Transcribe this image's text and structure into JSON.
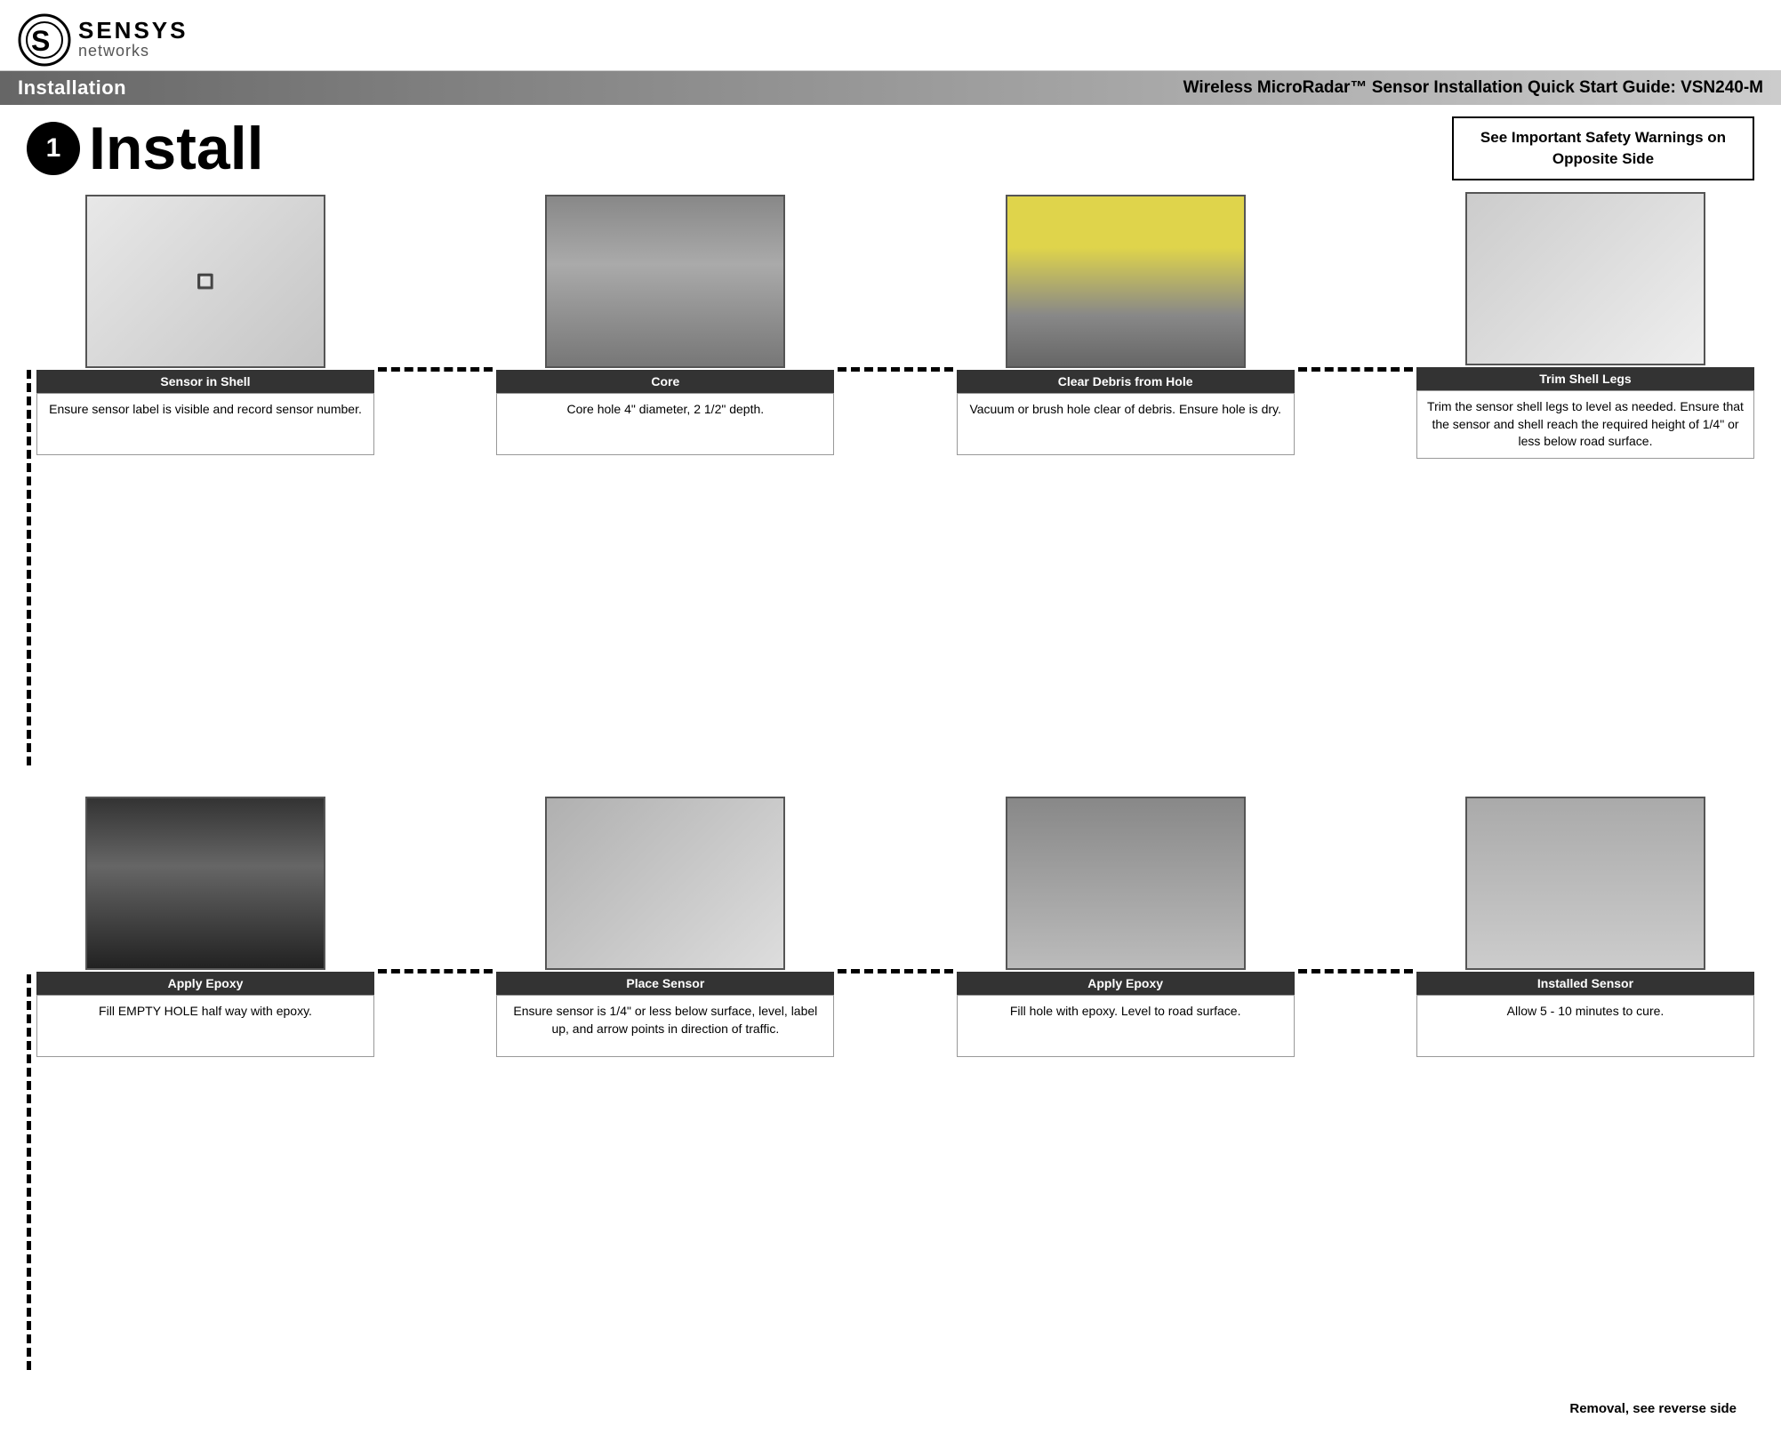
{
  "logo": {
    "brand": "SENSYS",
    "sub": "networks"
  },
  "title_bar": {
    "left": "Installation",
    "right": "Wireless MicroRadar™ Sensor Installation Quick Start Guide: VSN240-M"
  },
  "step1": {
    "number": "1",
    "title": "Install",
    "safety_warning": "See Important Safety Warnings on Opposite Side"
  },
  "row1": {
    "cards": [
      {
        "label": "Sensor in Shell",
        "desc": "Ensure sensor label is visible and record sensor number.",
        "photo_type": "sensor-in-shell"
      },
      {
        "label": "Core",
        "desc": "Core hole 4\" diameter, 2 1/2\" depth.",
        "photo_type": "core"
      },
      {
        "label": "Clear Debris from Hole",
        "desc": "Vacuum or brush hole clear of debris.  Ensure hole is dry.",
        "photo_type": "clear-debris"
      },
      {
        "label": "Trim Shell Legs",
        "desc": "Trim the sensor shell legs to level as needed. Ensure that the sensor and shell reach the required height of 1/4\" or less below road surface.",
        "photo_type": "trim-shell"
      }
    ]
  },
  "row2": {
    "cards": [
      {
        "label": "Apply Epoxy",
        "desc": "Fill EMPTY HOLE half way with epoxy.",
        "photo_type": "apply-epoxy"
      },
      {
        "label": "Place Sensor",
        "desc": "Ensure sensor is 1/4\" or less below surface, level, label up, and arrow points in direction of traffic.",
        "photo_type": "place-sensor"
      },
      {
        "label": "Apply Epoxy",
        "desc": "Fill hole with epoxy. Level to road surface.",
        "photo_type": "apply-epoxy2"
      },
      {
        "label": "Installed Sensor",
        "desc": "Allow 5 - 10 minutes to cure.",
        "photo_type": "installed"
      }
    ]
  },
  "removal_note": "Removal, see reverse side"
}
